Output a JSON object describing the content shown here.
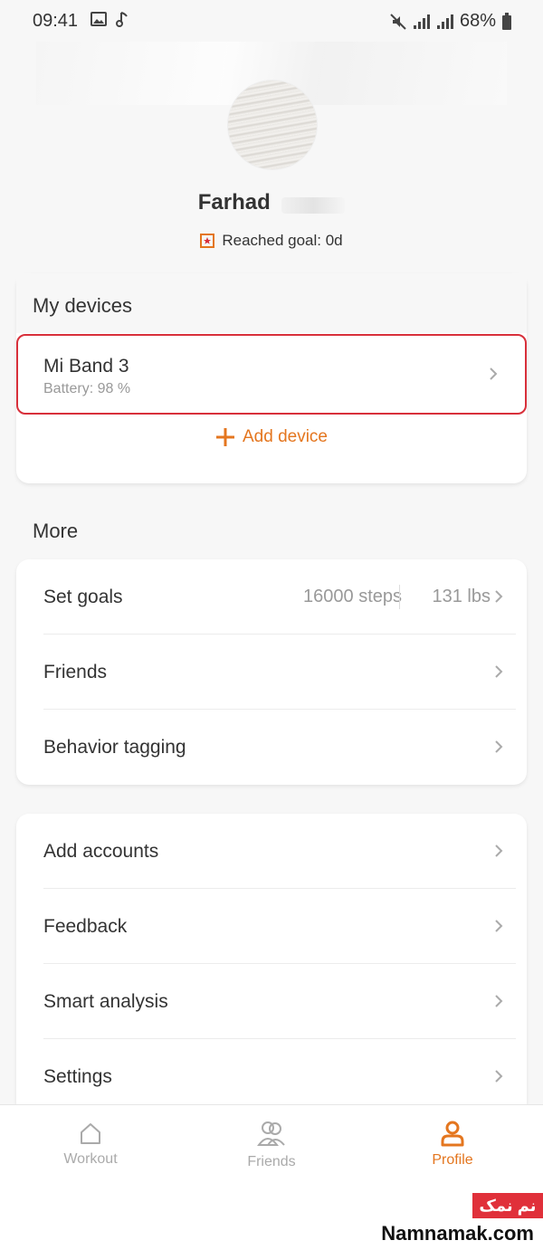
{
  "status_bar": {
    "time": "09:41",
    "battery": "68%",
    "icons": [
      "image-icon",
      "music-note-icon",
      "mute-icon",
      "signal-icon",
      "signal-icon",
      "battery-icon"
    ]
  },
  "profile": {
    "name": "Farhad",
    "goal_text": "Reached goal: 0d"
  },
  "devices": {
    "section_title": "My devices",
    "device_name": "Mi Band 3",
    "battery_text": "Battery: 98 %",
    "add_device_label": "Add device"
  },
  "more": {
    "section_title": "More",
    "set_goals_label": "Set goals",
    "steps_value": "16000 steps",
    "weight_value": "131 lbs",
    "friends_label": "Friends",
    "behavior_label": "Behavior tagging"
  },
  "menu": {
    "add_accounts": "Add accounts",
    "feedback": "Feedback",
    "smart_analysis": "Smart analysis",
    "settings": "Settings"
  },
  "bottom_nav": {
    "workout": "Workout",
    "friends": "Friends",
    "profile": "Profile"
  },
  "colors": {
    "accent": "#e4761f",
    "highlight": "#d8303b",
    "background": "#f7f7f7"
  },
  "watermark": {
    "badge": "نم نمک",
    "text": "Namnamak.com"
  }
}
